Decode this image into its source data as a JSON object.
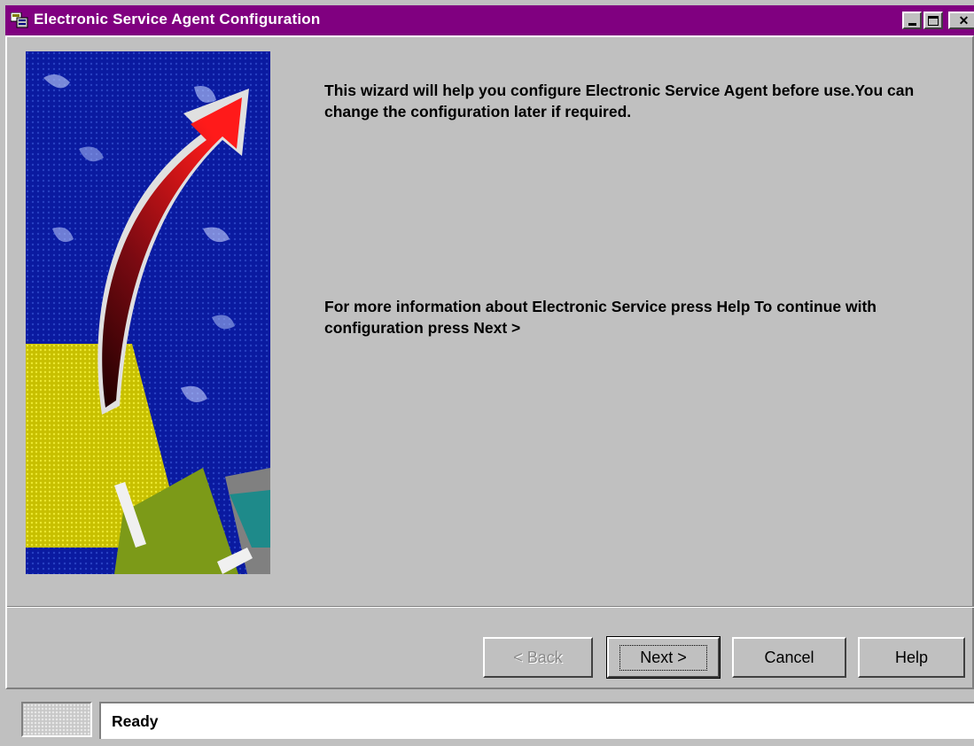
{
  "window": {
    "title": "Electronic Service Agent Configuration",
    "title_bar_color": "#800080",
    "icons": {
      "app": "app-window-icon",
      "minimize": "minimize-icon",
      "maximize": "maximize-icon",
      "close": "close-icon"
    },
    "close_glyph": "✕"
  },
  "wizard": {
    "intro_text": "This wizard will help you configure Electronic Service Agent before use.You can change the configuration later if required.",
    "help_text": "For more information about Electronic Service press Help To continue with configuration press Next >"
  },
  "buttons": {
    "back_label": "< Back",
    "back_enabled": false,
    "next_label": "Next >",
    "cancel_label": "Cancel",
    "help_label": "Help"
  },
  "status": {
    "text": "Ready"
  },
  "colors": {
    "window_background": "#c0c0c0",
    "artwork_blue": "#0a1aa0",
    "arrow_red": "#e8141c",
    "artwork_yellow": "#c8c000"
  }
}
